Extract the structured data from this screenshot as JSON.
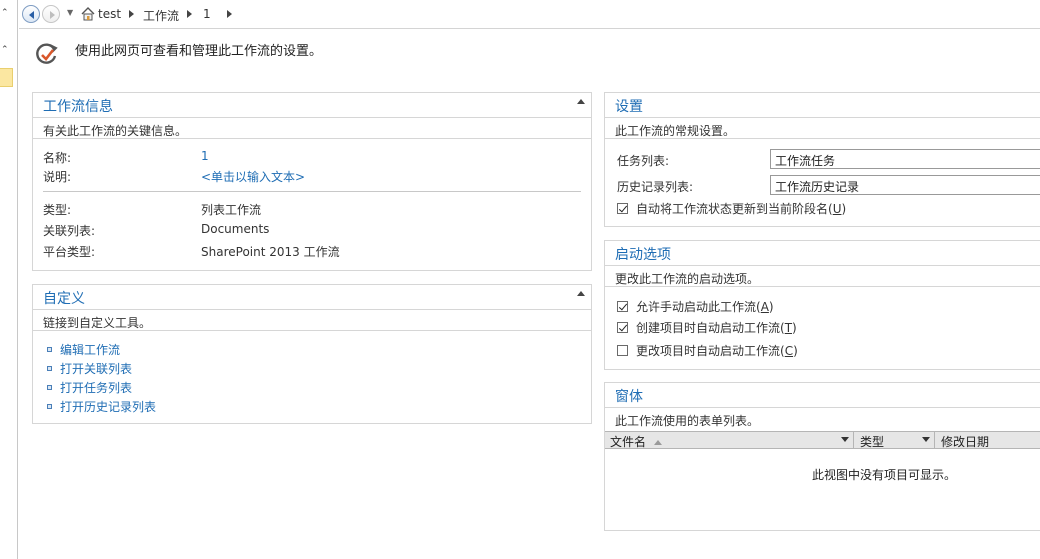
{
  "breadcrumb": {
    "items": [
      "test",
      "工作流",
      "1"
    ]
  },
  "intro": {
    "text": "使用此网页可查看和管理此工作流的设置。"
  },
  "workflow_info": {
    "title": "工作流信息",
    "subtitle": "有关此工作流的关键信息。",
    "fields": {
      "name_label": "名称:",
      "name_value": "1",
      "desc_label": "说明:",
      "desc_value": "<单击以输入文本>",
      "type_label": "类型:",
      "type_value": "列表工作流",
      "list_label": "关联列表:",
      "list_value": "Documents",
      "platform_label": "平台类型:",
      "platform_value": "SharePoint 2013 工作流"
    }
  },
  "customization": {
    "title": "自定义",
    "subtitle": "链接到自定义工具。",
    "links": [
      "编辑工作流",
      "打开关联列表",
      "打开任务列表",
      "打开历史记录列表"
    ]
  },
  "settings": {
    "title": "设置",
    "subtitle": "此工作流的常规设置。",
    "task_list_label": "任务列表:",
    "task_list_value": "工作流任务",
    "history_list_label": "历史记录列表:",
    "history_list_value": "工作流历史记录",
    "auto_update": {
      "text": "自动将工作流状态更新到当前阶段名(",
      "key": "U",
      "close": ")",
      "checked": true
    }
  },
  "startup": {
    "title": "启动选项",
    "subtitle": "更改此工作流的启动选项。",
    "options": [
      {
        "text": "允许手动启动此工作流(",
        "key": "A",
        "close": ")",
        "checked": true
      },
      {
        "text": "创建项目时自动启动工作流(",
        "key": "T",
        "close": ")",
        "checked": true
      },
      {
        "text": "更改项目时自动启动工作流(",
        "key": "C",
        "close": ")",
        "checked": false
      }
    ]
  },
  "forms": {
    "title": "窗体",
    "subtitle": "此工作流使用的表单列表。",
    "columns": [
      "文件名",
      "类型",
      "修改日期"
    ],
    "empty_message": "此视图中没有项目可显示。"
  },
  "colors": {
    "link": "#1f6db4",
    "border": "#d6d6d6",
    "highlight": "#fbe7a1"
  }
}
